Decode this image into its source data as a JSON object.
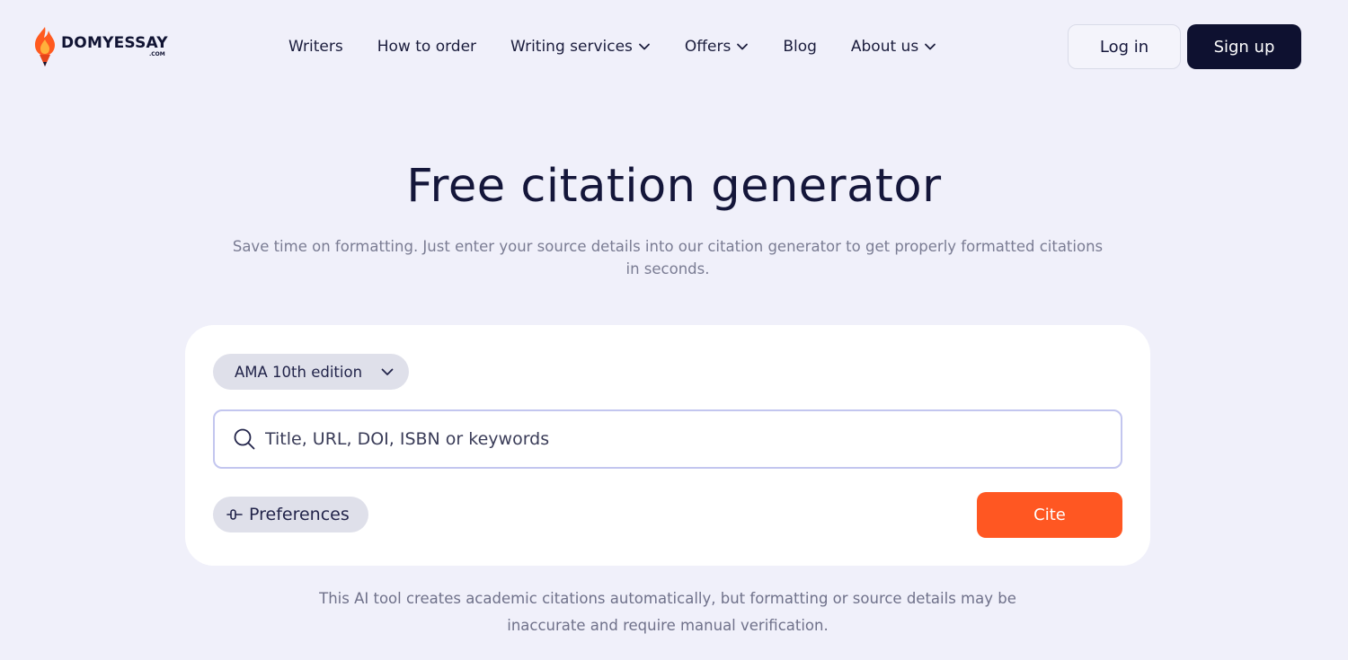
{
  "header": {
    "logo": {
      "text": "DOMYESSAY",
      "sub": ".COM",
      "icon": "flame-pencil-icon"
    },
    "nav": [
      {
        "label": "Writers",
        "has_dropdown": false
      },
      {
        "label": "How to order",
        "has_dropdown": false
      },
      {
        "label": "Writing services",
        "has_dropdown": true
      },
      {
        "label": "Offers",
        "has_dropdown": true
      },
      {
        "label": "Blog",
        "has_dropdown": false
      },
      {
        "label": "About us",
        "has_dropdown": true
      }
    ],
    "login_label": "Log in",
    "signup_label": "Sign up"
  },
  "hero": {
    "title": "Free citation generator",
    "subtitle": "Save time on formatting. Just enter your source details into our citation generator to get properly formatted citations in seconds."
  },
  "generator": {
    "style_selected": "AMA 10th edition",
    "search_placeholder": "Title, URL, DOI, ISBN or keywords",
    "search_value": "",
    "preferences_label": "Preferences",
    "cite_label": "Cite"
  },
  "disclaimer": "This AI tool creates academic citations automatically, but formatting or source details may be inaccurate and require manual verification.",
  "colors": {
    "background": "#f0f0fa",
    "accent": "#ff5722",
    "dark": "#0e1130",
    "input_border": "#c3c6ef"
  }
}
